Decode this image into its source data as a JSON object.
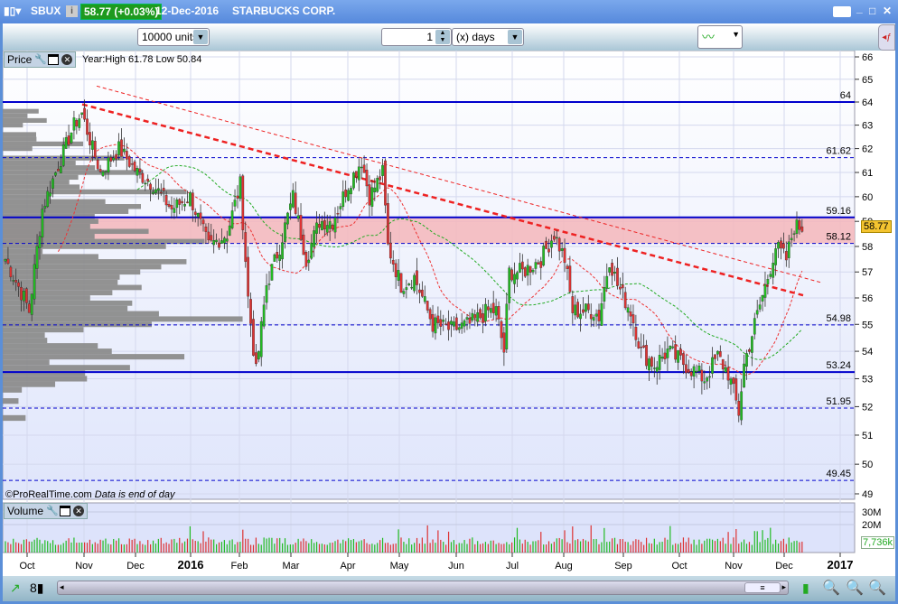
{
  "title": {
    "symbol": "SBUX",
    "price_change": "58.77 (+0.03%)",
    "date": "12-Dec-2016",
    "company": "STARBUCKS CORP."
  },
  "toolbar": {
    "units": "10000 units",
    "period_value": "1",
    "period_unit": "(x) days"
  },
  "price_panel": {
    "label": "Price",
    "info": "Year:High 61.78 Low 50.84",
    "footer_copyright": "©ProRealTime.com",
    "footer_note": "Data is end of day",
    "last_price": "58.77"
  },
  "volume_panel": {
    "label": "Volume",
    "last_volume": "7,736k",
    "axis_labels": [
      "30M",
      "20M"
    ]
  },
  "colors": {
    "up": "#22bb22",
    "down": "#dd3333",
    "level": "#0000cc",
    "band": "#f4b6bb",
    "trend": "#ee2222"
  },
  "chart_data": {
    "type": "candlestick",
    "y_ticks": [
      66,
      65,
      64,
      63,
      62,
      61,
      60,
      59,
      58,
      57,
      56,
      55,
      54,
      53,
      52,
      51,
      50,
      49
    ],
    "x_ticks": [
      "Oct",
      "Nov",
      "Dec",
      "2016",
      "Feb",
      "Mar",
      "Apr",
      "May",
      "Jun",
      "Jul",
      "Aug",
      "Sep",
      "Oct",
      "Nov",
      "Dec",
      "2017"
    ],
    "levels": [
      {
        "value": 64,
        "style": "solid",
        "label": "64"
      },
      {
        "value": 61.62,
        "style": "dashed",
        "label": "61.62"
      },
      {
        "value": 59.16,
        "style": "solid",
        "label": "59.16"
      },
      {
        "value": 58.12,
        "style": "dashed",
        "label": "58.12"
      },
      {
        "value": 54.98,
        "style": "dashed",
        "label": "54.98"
      },
      {
        "value": 53.24,
        "style": "solid",
        "label": "53.24"
      },
      {
        "value": 51.95,
        "style": "dashed",
        "label": "51.95"
      },
      {
        "value": 49.45,
        "style": "dashed",
        "label": "49.45"
      }
    ],
    "band": [
      58.12,
      59.16
    ],
    "close_path": [
      [
        0,
        57.5
      ],
      [
        7,
        56
      ],
      [
        9,
        55.5
      ],
      [
        14,
        59.5
      ],
      [
        19,
        61
      ],
      [
        26,
        63
      ],
      [
        29,
        63.5
      ],
      [
        33,
        62
      ],
      [
        36,
        61
      ],
      [
        43,
        62
      ],
      [
        50,
        61
      ],
      [
        56,
        60.5
      ],
      [
        63,
        59.5
      ],
      [
        70,
        60
      ],
      [
        77,
        58
      ],
      [
        84,
        58.5
      ],
      [
        89,
        60.5
      ],
      [
        92,
        56
      ],
      [
        95,
        53.2
      ],
      [
        99,
        56.5
      ],
      [
        104,
        58
      ],
      [
        109,
        60
      ],
      [
        114,
        57.5
      ],
      [
        119,
        59
      ],
      [
        124,
        59
      ],
      [
        130,
        60.5
      ],
      [
        135,
        61.5
      ],
      [
        138,
        60
      ],
      [
        143,
        61
      ],
      [
        145,
        58
      ],
      [
        150,
        56.5
      ],
      [
        155,
        56.8
      ],
      [
        162,
        55
      ],
      [
        169,
        54.8
      ],
      [
        176,
        55
      ],
      [
        183,
        55.5
      ],
      [
        186,
        55.5
      ],
      [
        189,
        54
      ],
      [
        191,
        57
      ],
      [
        196,
        57
      ],
      [
        203,
        57.5
      ],
      [
        208,
        58.5
      ],
      [
        212,
        57.5
      ],
      [
        215,
        55.5
      ],
      [
        223,
        55.5
      ],
      [
        225,
        55.3
      ],
      [
        229,
        57.5
      ],
      [
        232,
        56.5
      ],
      [
        237,
        55.5
      ],
      [
        241,
        54
      ],
      [
        246,
        53.5
      ],
      [
        251,
        54
      ],
      [
        258,
        53.5
      ],
      [
        265,
        53
      ],
      [
        270,
        53.8
      ],
      [
        274,
        53.2
      ],
      [
        278,
        51.8
      ],
      [
        280,
        53.5
      ],
      [
        284,
        55
      ],
      [
        289,
        56.8
      ],
      [
        292,
        58
      ],
      [
        296,
        57.5
      ],
      [
        299,
        58.8
      ],
      [
        302,
        58.77
      ]
    ]
  }
}
